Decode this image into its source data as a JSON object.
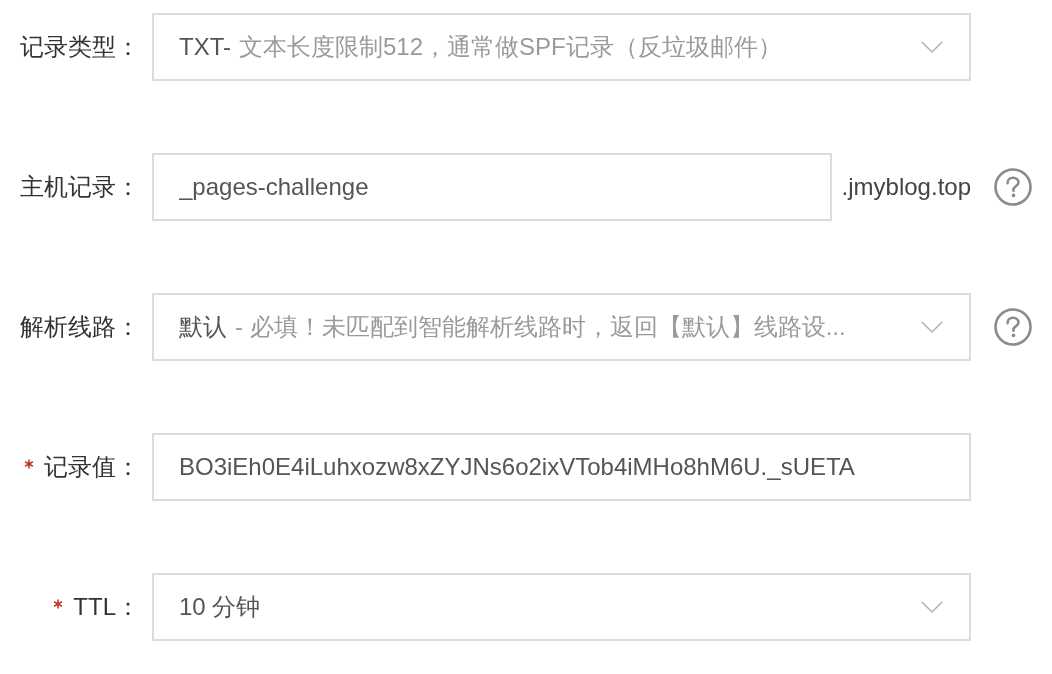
{
  "form": {
    "rows": [
      {
        "label": "记录类型：",
        "required": false,
        "kind": "select",
        "value": "TXT-",
        "description": "文本长度限制512，通常做SPF记录（反垃圾邮件）",
        "help": false
      },
      {
        "label": "主机记录：",
        "required": false,
        "kind": "input",
        "value": "_pages-challenge",
        "suffix": ".jmyblog.top",
        "help": true
      },
      {
        "label": "解析线路：",
        "required": false,
        "kind": "select",
        "value": "默认",
        "description": "- 必填！未匹配到智能解析线路时，返回【默认】线路设...",
        "help": true
      },
      {
        "label": "记录值：",
        "required": true,
        "kind": "input",
        "value": "BO3iEh0E4iLuhxozw8xZYJNs6o2ixVTob4iMHo8hM6U._sUETA",
        "help": false
      },
      {
        "label": "TTL：",
        "required": true,
        "kind": "select",
        "value": "10 分钟",
        "help": false
      }
    ]
  }
}
